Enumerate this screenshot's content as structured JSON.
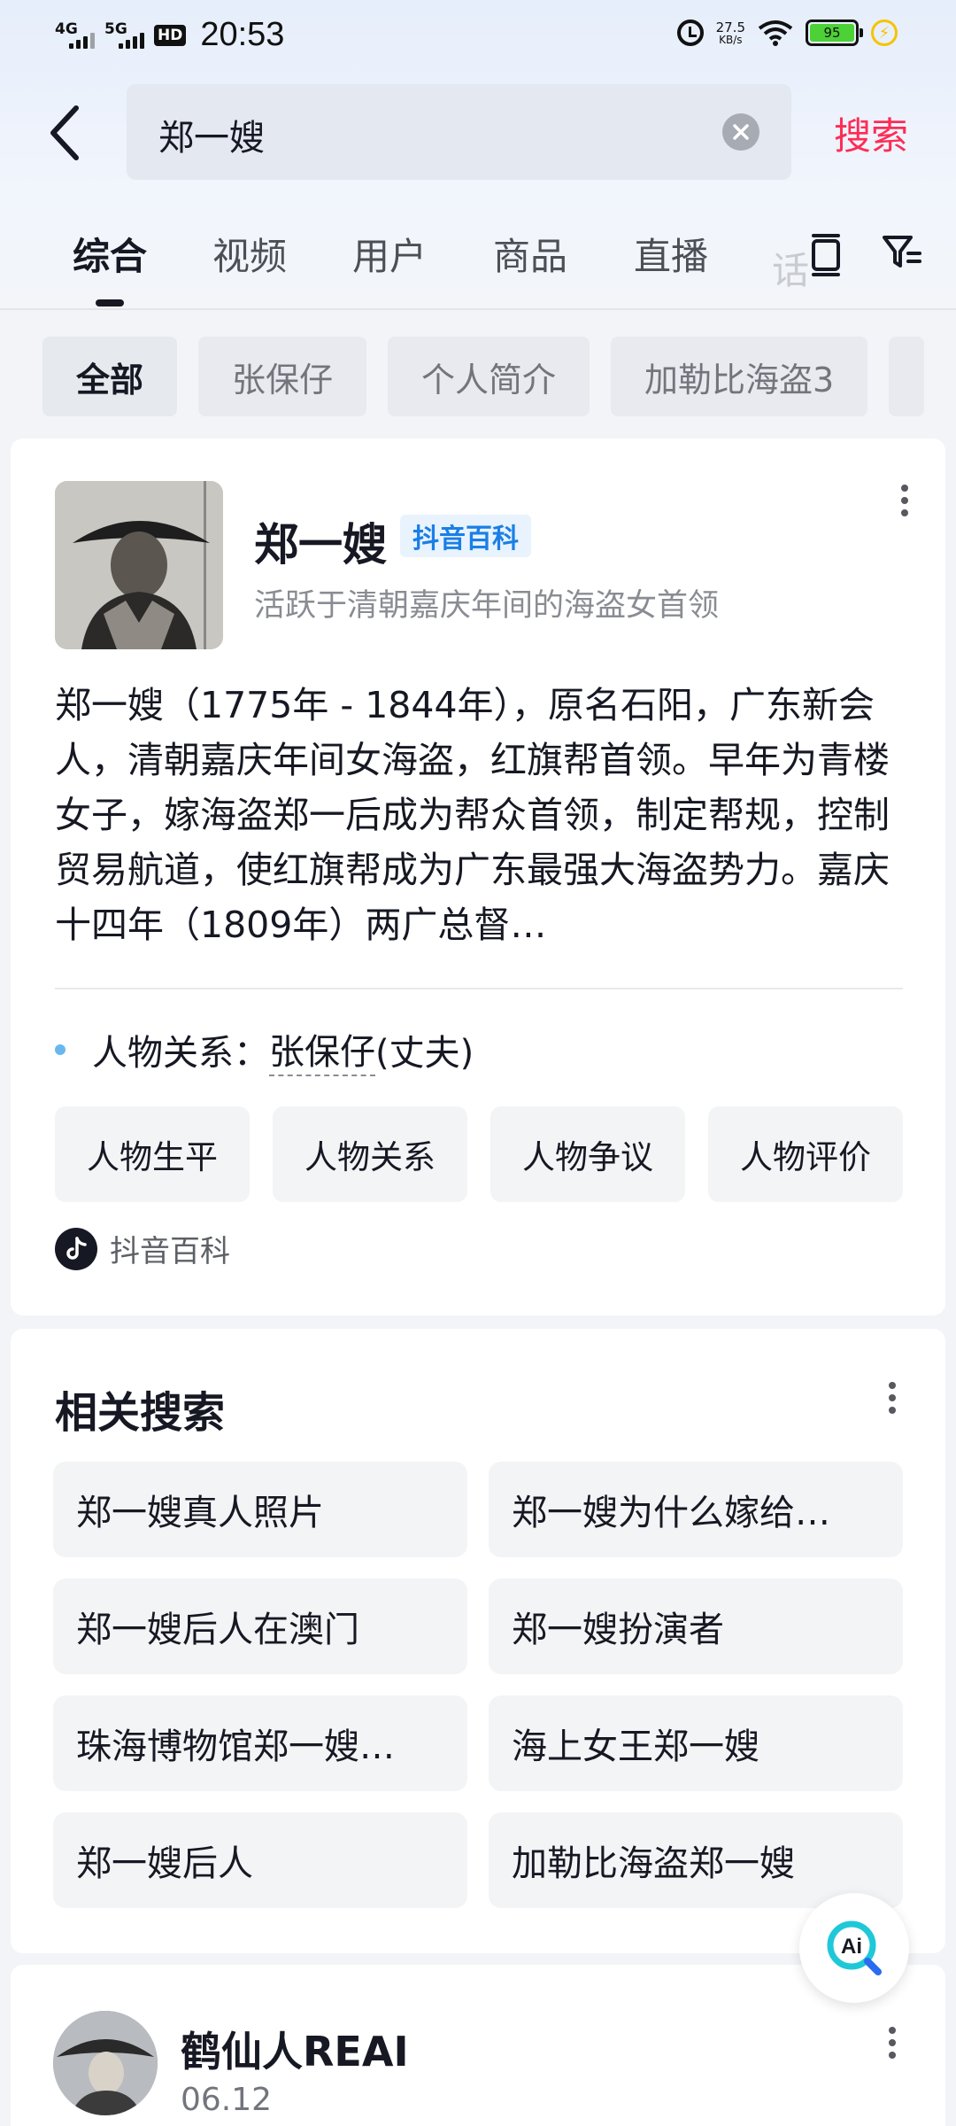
{
  "status_bar": {
    "net1": "4G",
    "net2": "5G",
    "hd": "HD",
    "time": "20:53",
    "speed_value": "27.5",
    "speed_unit": "KB/s",
    "battery": "95"
  },
  "search": {
    "query": "郑一嫂",
    "search_button": "搜索"
  },
  "tabs": {
    "items": [
      "综合",
      "视频",
      "用户",
      "商品",
      "直播"
    ],
    "active": "综合",
    "fade": "话"
  },
  "chips": {
    "items": [
      "全部",
      "张保仔",
      "个人简介",
      "加勒比海盗3"
    ],
    "active": "全部"
  },
  "baike": {
    "title": "郑一嫂",
    "badge": "抖音百科",
    "subtitle": "活跃于清朝嘉庆年间的海盗女首领",
    "description": "郑一嫂（1775年 - 1844年），原名石阳，广东新会人，清朝嘉庆年间女海盗，红旗帮首领。早年为青楼女子，嫁海盗郑一后成为帮众首领，制定帮规，控制贸易航道，使红旗帮成为广东最强大海盗势力。嘉庆十四年（1809年）两广总督…",
    "relation_label": "人物关系：",
    "relation_name": "张保仔",
    "relation_suffix": "(丈夫)",
    "feature_chips": [
      "人物生平",
      "人物关系",
      "人物争议",
      "人物评价"
    ],
    "source": "抖音百科"
  },
  "related": {
    "title": "相关搜索",
    "items": [
      "郑一嫂真人照片",
      "郑一嫂为什么嫁给…",
      "郑一嫂后人在澳门",
      "郑一嫂扮演者",
      "珠海博物馆郑一嫂…",
      "海上女王郑一嫂",
      "郑一嫂后人",
      "加勒比海盗郑一嫂"
    ]
  },
  "post": {
    "username": "鹤仙人REAI",
    "date": "06.12"
  },
  "colors": {
    "accent": "#fe2c55",
    "badge_blue": "#1a7fe6",
    "battery_green": "#4cd137"
  }
}
